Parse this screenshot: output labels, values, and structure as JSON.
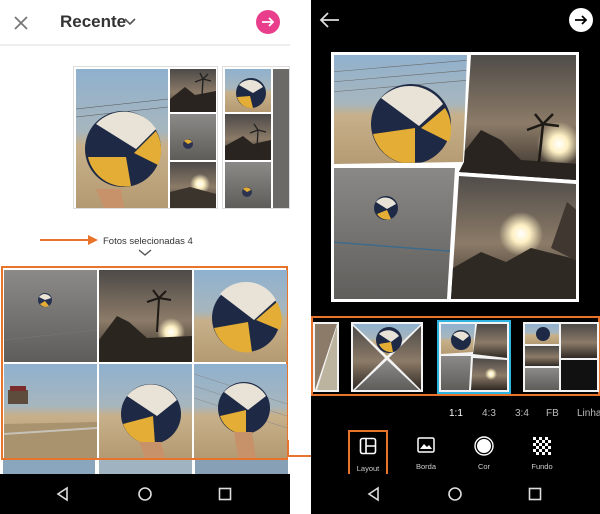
{
  "left_screen": {
    "header": {
      "title": "Recente"
    },
    "selected_label": "Fotos selecionadas 4"
  },
  "right_screen": {
    "ratios": [
      "1:1",
      "4:3",
      "3:4",
      "FB",
      "Linha"
    ],
    "active_ratio": "1:1",
    "tools": [
      {
        "label": "Layout",
        "icon": "layout-icon",
        "active": true
      },
      {
        "label": "Borda",
        "icon": "image-icon",
        "active": false
      },
      {
        "label": "Cor",
        "icon": "color-circle-icon",
        "active": false
      },
      {
        "label": "Fundo",
        "icon": "checker-pattern-icon",
        "active": false
      }
    ]
  },
  "colors": {
    "accent_orange": "#e8732a",
    "accent_pink": "#e83e8c",
    "highlight_blue": "#2db4e0"
  }
}
